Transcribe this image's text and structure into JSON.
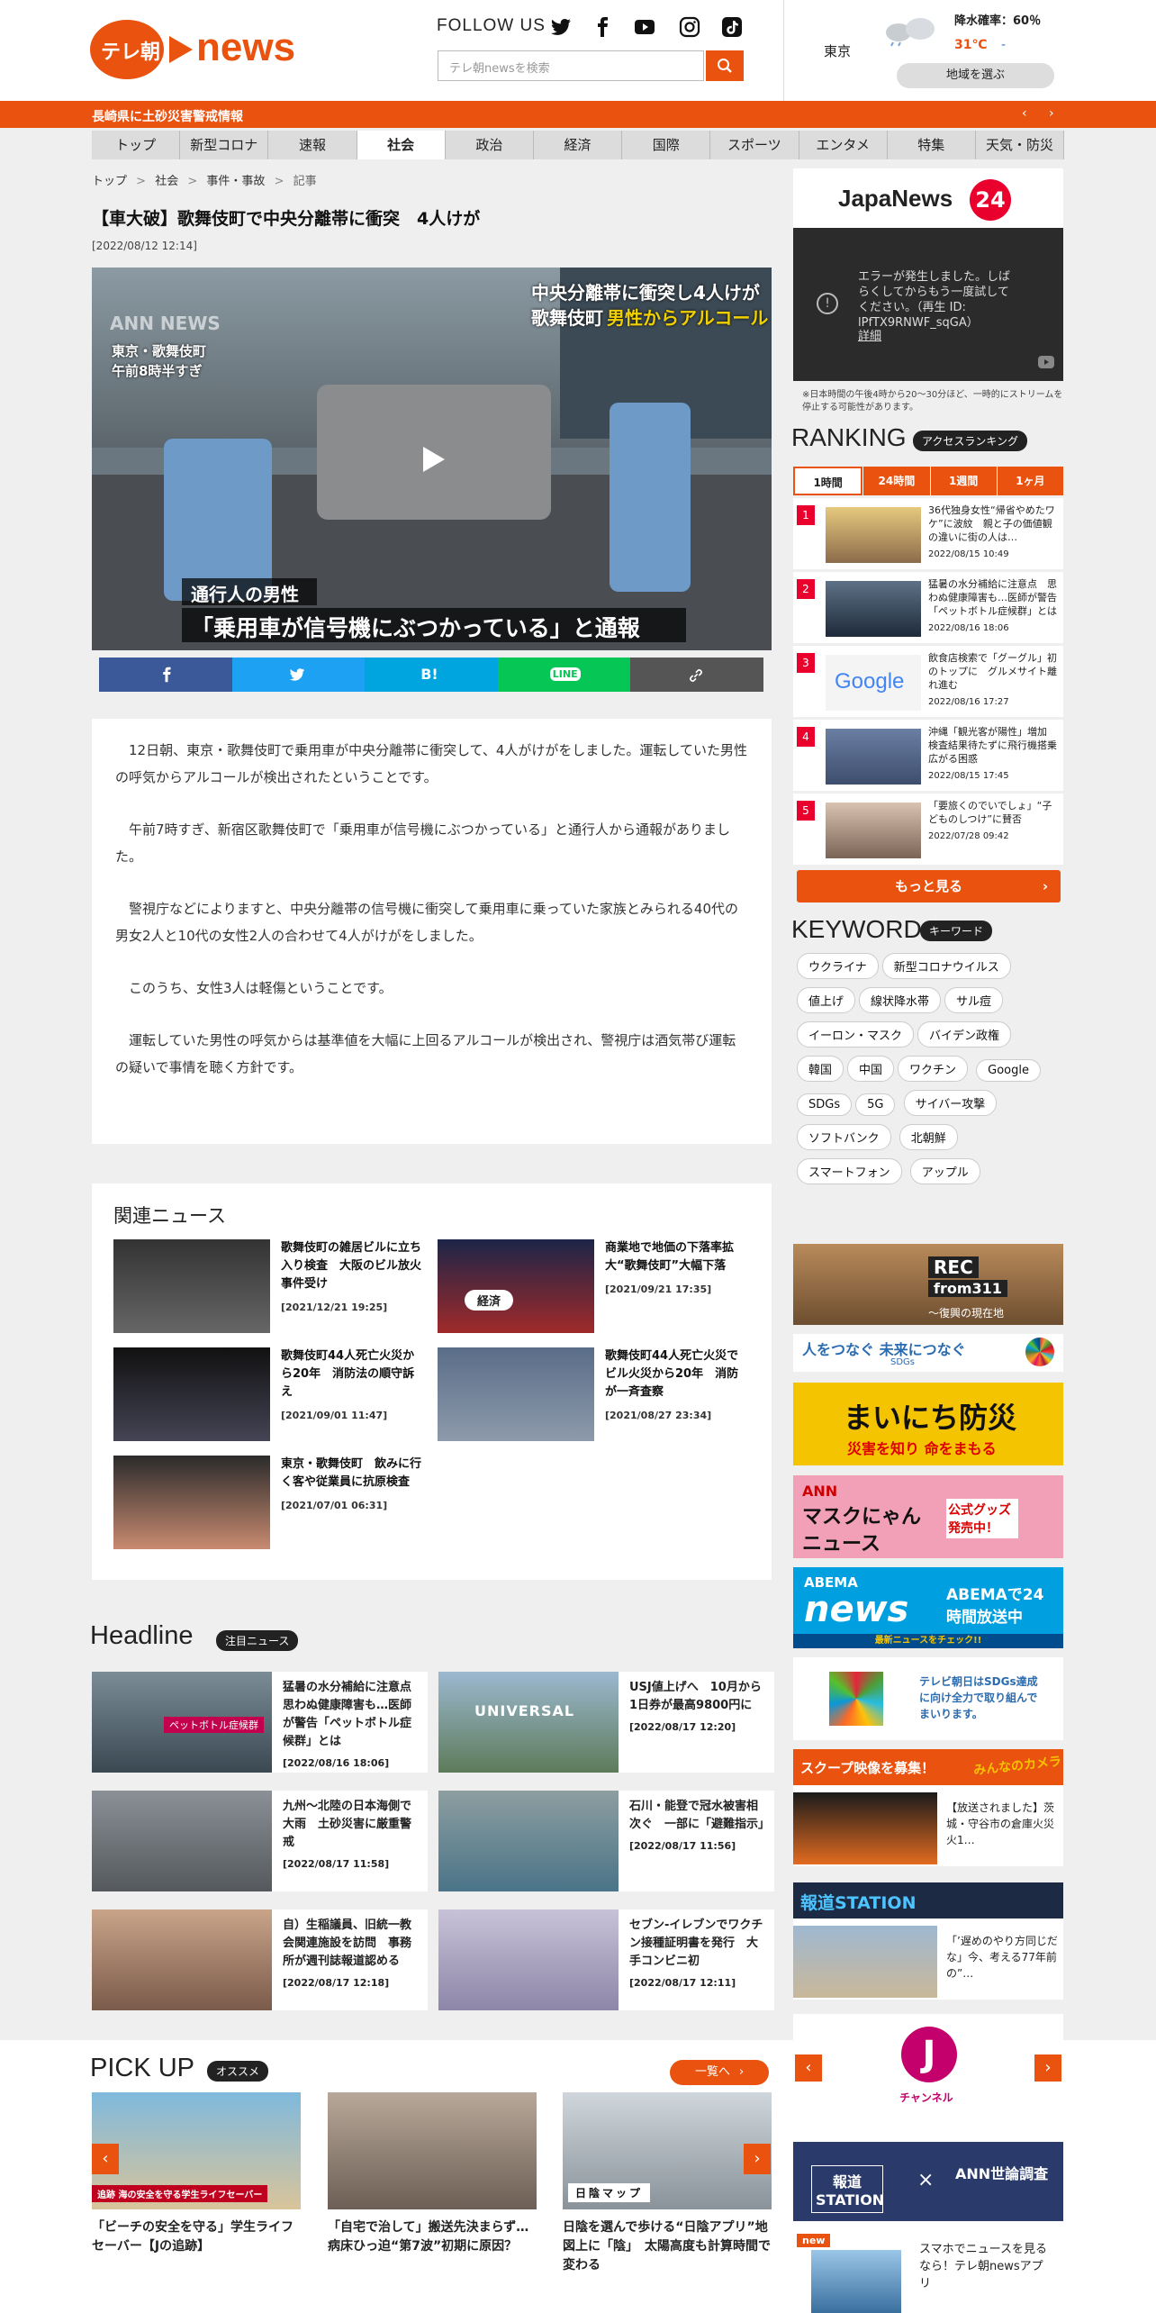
{
  "header": {
    "logo_jp": "テレ朝",
    "logo_en": "news",
    "follow": "FOLLOW US",
    "search_placeholder": "テレ朝newsを検索"
  },
  "weather": {
    "city": "東京",
    "rain_label": "降水確率：60％",
    "temp_high": "31℃",
    "temp_low": "-",
    "region_btn": "地域を選ぶ"
  },
  "alert": {
    "text": "長崎県に土砂災害警戒情報"
  },
  "nav": [
    "トップ",
    "新型コロナ",
    "速報",
    "社会",
    "政治",
    "経済",
    "国際",
    "スポーツ",
    "エンタメ",
    "特集",
    "天気・防災"
  ],
  "breadcrumb": {
    "items": [
      "トップ",
      "社会",
      "事件・事故",
      "記事"
    ],
    "sep": ">"
  },
  "article": {
    "title": "【車大破】歌舞伎町で中央分離帯に衝突　4人けが",
    "date": "[2022/08/12 12:14]",
    "caption_top1": "中央分離帯に衝突し4人けが",
    "caption_top2a": "歌舞伎町",
    "caption_top2b": "男性からアルコール",
    "loc1": "東京・歌舞伎町",
    "loc2": "午前8時半すぎ",
    "ann": "ANN NEWS",
    "caption_sub": "通行人の男性",
    "caption_main": "「乗用車が信号機にぶつかっている」と通報",
    "paragraphs": [
      "12日朝、東京・歌舞伎町で乗用車が中央分離帯に衝突して、4人がけがをしました。運転していた男性の呼気からアルコールが検出されたということです。",
      "午前7時すぎ、新宿区歌舞伎町で「乗用車が信号機にぶつかっている」と通行人から通報がありました。",
      "警視庁などによりますと、中央分離帯の信号機に衝突して乗用車に乗っていた家族とみられる40代の男女2人と10代の女性2人の合わせて4人がけがをしました。",
      "このうち、女性3人は軽傷ということです。",
      "運転していた男性の呼気からは基準値を大幅に上回るアルコールが検出され、警視庁は酒気帯び運転の疑いで事情を聴く方針です。"
    ]
  },
  "share": {
    "hatena": "B!",
    "line": "LINE",
    "colors": [
      "#3b5998",
      "#1da1f2",
      "#00a4de",
      "#06c755",
      "#555555"
    ]
  },
  "related": {
    "title": "関連ニュース",
    "items": [
      {
        "title": "歌舞伎町の雑居ビルに立ち入り検査　大阪のビル放火事件受け",
        "date": "[2021/12/21 19:25]"
      },
      {
        "title": "商業地で地価の下落率拡大“歌舞伎町”大幅下落",
        "date": "[2021/09/21 17:35]",
        "badge": "経済"
      },
      {
        "title": "歌舞伎町44人死亡火災から20年　消防法の順守訴え",
        "date": "[2021/09/01 11:47]"
      },
      {
        "title": "歌舞伎町44人死亡火災でビル火災から20年　消防が一斉査察",
        "date": "[2021/08/27 23:34]"
      },
      {
        "title": "東京・歌舞伎町　飲みに行く客や従業員に抗原検査",
        "date": "[2021/07/01 06:31]"
      }
    ]
  },
  "headline": {
    "title": "Headline",
    "tag": "注目ニュース",
    "items": [
      {
        "title": "猛暑の水分補給に注意点　思わぬ健康障害も…医師が警告「ペットボトル症候群」とは",
        "date": "[2022/08/16 18:06]",
        "thumb_label": "ペットボトル症候群"
      },
      {
        "title": "USJ値上げへ　10月から1日券が最高9800円に",
        "date": "[2022/08/17 12:20]",
        "thumb_label": "UNIVERSAL"
      },
      {
        "title": "九州〜北陸の日本海側で大雨　土砂災害に厳重警戒",
        "date": "[2022/08/17 11:58]"
      },
      {
        "title": "石川・能登で冠水被害相次ぐ　一部に「避難指示」",
        "date": "[2022/08/17 11:56]"
      },
      {
        "title": "自）生稲議員、旧統一教会関連施設を訪問　事務所が週刊誌報道認める",
        "date": "[2022/08/17 12:18]"
      },
      {
        "title": "セブン-イレブンでワクチン接種証明書を発行　大手コンビニ初",
        "date": "[2022/08/17 12:11]"
      }
    ]
  },
  "pickup": {
    "title": "PICK UP",
    "tag": "オススメ",
    "more": "一覧へ",
    "items": [
      {
        "title": "「ビーチの安全を守る」学生ライフセーバー【Jの追跡】",
        "thumb_label": "追跡 海の安全を守る学生ライフセーバー"
      },
      {
        "title": "「自宅で治して」搬送先決まらず…病床ひっ迫“第7波”初期に原因？"
      },
      {
        "title": "日陰を選んで歩ける“日陰アプリ”地図上に「陰」　太陽高度も計算時間で変わる",
        "thumb_label": "日陰マップ"
      }
    ]
  },
  "sidebar": {
    "japanews": "JapaNews",
    "japanews_num": "24",
    "error_msg": "エラーが発生しました。しばらくしてからもう一度試してください。（再生 ID: lPfTX9RNWF_sqGA）",
    "error_link": "詳細",
    "note": "※日本時間の午後4時から20～30分ほど、一時的にストリームを停止する可能性があります。",
    "ranking_title": "RANKING",
    "ranking_tag": "アクセスランキング",
    "tabs": [
      "1時間",
      "24時間",
      "1週間",
      "1ヶ月"
    ],
    "ranking": [
      {
        "rank": "1",
        "title": "36代独身女性“帰省やめたワケ”に波紋　親と子の価値観の違いに街の人は…",
        "date": "2022/08/15 10:49"
      },
      {
        "rank": "2",
        "title": "猛暑の水分補給に注意点　思わぬ健康障害も…医師が警告「ペットボトル症候群」とは",
        "date": "2022/08/16 18:06"
      },
      {
        "rank": "3",
        "title": "飲食店検索で「グーグル」初のトップに　グルメサイト離れ進む",
        "date": "2022/08/16 17:27",
        "thumb_label": "Google"
      },
      {
        "rank": "4",
        "title": "沖縄「観光客が陽性」増加　検査結果待たずに飛行機搭乗　広がる困惑",
        "date": "2022/08/15 17:45"
      },
      {
        "rank": "5",
        "title": "「要旅くのでいでしょ」“子どものしつけ”に賛否",
        "date": "2022/07/28 09:42"
      }
    ],
    "more_btn": "もっと見る",
    "keyword_title": "KEYWORD",
    "keyword_tag": "キーワード",
    "keywords": [
      "ウクライナ",
      "新型コロナウイルス",
      "値上げ",
      "線状降水帯",
      "サル痘",
      "イーロン・マスク",
      "バイデン政権",
      "韓国",
      "中国",
      "ワクチン",
      "Google",
      "SDGs",
      "5G",
      "サイバー攻撃",
      "ソフトバンク",
      "北朝鮮",
      "スマートフォン",
      "アップル"
    ],
    "banners": {
      "rec_a": "REC",
      "rec_b": "from311",
      "rec_c": "～復興の現在地",
      "sdgs_line": "人をつなぐ 未来につなぐ",
      "sdgs_small": "SDGs",
      "bousai1": "まいにち防災",
      "bousai2": "災害を知り 命をまもる",
      "mask1": "ANN",
      "mask2": "マスクにゃん",
      "mask3": "ニュース",
      "mask4": "公式グッズ発売中！",
      "abema1": "ABEMA",
      "abema2": "news",
      "abema3": "ABEMAで24時間放送中",
      "abema4": "最新ニュースをチェック!!",
      "sdgs2": "テレビ朝日はSDGs達成に向け全力で取り組んでまいります。",
      "scoop_title": "スクープ映像を募集！",
      "scoop_logo": "みんなのカメラ",
      "scoop_text": "【放送されました】茨城・守谷市の倉庫火災　火1…",
      "hodo_title": "報道STATION",
      "hodo_text": "「’遅めのやり方同じだな」今、考える77年前の”…",
      "jch": "チャンネル",
      "survey1": "報道STATION",
      "survey2": "ANN世論調査",
      "new_badge": "new",
      "app_text": "スマホでニュースを見るなら！テレ朝newsアプリ"
    }
  }
}
